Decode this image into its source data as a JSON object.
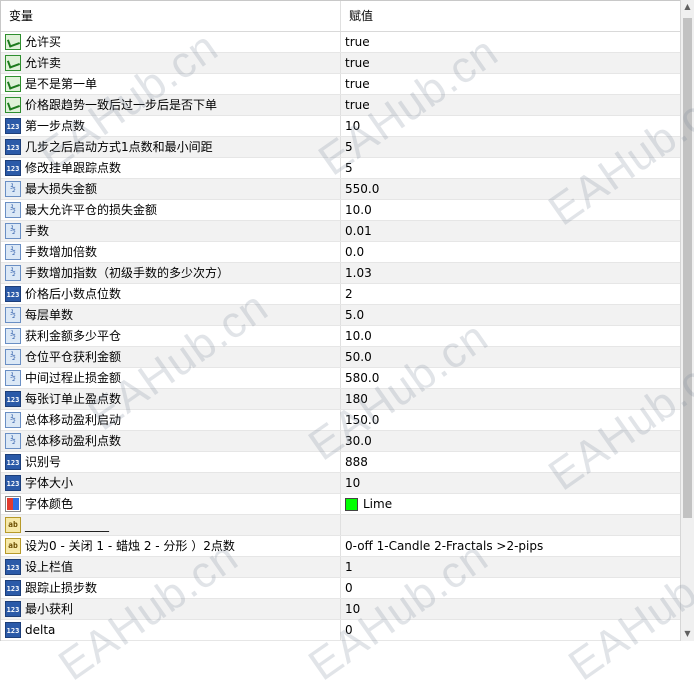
{
  "header": {
    "col_variable": "变量",
    "col_value": "赋值"
  },
  "rows": [
    {
      "icon": "bool-icon",
      "kind": "bool",
      "name": "允许买",
      "value": "true"
    },
    {
      "icon": "bool-icon",
      "kind": "bool",
      "name": "允许卖",
      "value": "true"
    },
    {
      "icon": "bool-icon",
      "kind": "bool",
      "name": "是不是第一单",
      "value": "true"
    },
    {
      "icon": "bool-icon",
      "kind": "bool",
      "name": "价格跟趋势一致后过一步后是否下单",
      "value": "true"
    },
    {
      "icon": "int-icon",
      "kind": "int",
      "name": "第一步点数",
      "value": "10"
    },
    {
      "icon": "int-icon",
      "kind": "int",
      "name": "几步之后启动方式1点数和最小间距",
      "value": "5"
    },
    {
      "icon": "int-icon",
      "kind": "int",
      "name": "修改挂单跟踪点数",
      "value": "5"
    },
    {
      "icon": "double-icon",
      "kind": "dbl",
      "name": "最大损失金额",
      "value": "550.0"
    },
    {
      "icon": "double-icon",
      "kind": "dbl",
      "name": "最大允许平仓的损失金额",
      "value": "10.0"
    },
    {
      "icon": "double-icon",
      "kind": "dbl",
      "name": "手数",
      "value": "0.01"
    },
    {
      "icon": "double-icon",
      "kind": "dbl",
      "name": "手数增加倍数",
      "value": "0.0"
    },
    {
      "icon": "double-icon",
      "kind": "dbl",
      "name": "手数增加指数（初级手数的多少次方）",
      "value": "1.03"
    },
    {
      "icon": "int-icon",
      "kind": "int",
      "name": "价格后小数点位数",
      "value": "2"
    },
    {
      "icon": "double-icon",
      "kind": "dbl",
      "name": "每层单数",
      "value": "5.0"
    },
    {
      "icon": "double-icon",
      "kind": "dbl",
      "name": "获利金额多少平仓",
      "value": "10.0"
    },
    {
      "icon": "double-icon",
      "kind": "dbl",
      "name": "仓位平仓获利金额",
      "value": "50.0"
    },
    {
      "icon": "double-icon",
      "kind": "dbl",
      "name": "中间过程止损金额",
      "value": "580.0"
    },
    {
      "icon": "int-icon",
      "kind": "int",
      "name": "每张订单止盈点数",
      "value": "180"
    },
    {
      "icon": "double-icon",
      "kind": "dbl",
      "name": "总体移动盈利启动",
      "value": "150.0"
    },
    {
      "icon": "double-icon",
      "kind": "dbl",
      "name": "总体移动盈利点数",
      "value": "30.0"
    },
    {
      "icon": "int-icon",
      "kind": "int",
      "name": "识别号",
      "value": "888"
    },
    {
      "icon": "int-icon",
      "kind": "int",
      "name": "字体大小",
      "value": "10"
    },
    {
      "icon": "color-icon",
      "kind": "clr",
      "name": "字体颜色",
      "value": "Lime",
      "swatch": "#00ff00"
    },
    {
      "icon": "string-icon",
      "kind": "str",
      "name": "______________",
      "value": ""
    },
    {
      "icon": "string-icon",
      "kind": "str",
      "name": "设为0 - 关闭 1 - 蜡烛 2 - 分形 ）2点数",
      "value": "0-off  1-Candle  2-Fractals  >2-pips"
    },
    {
      "icon": "int-icon",
      "kind": "int",
      "name": "设上栏值",
      "value": "1"
    },
    {
      "icon": "int-icon",
      "kind": "int",
      "name": "跟踪止损步数",
      "value": "0"
    },
    {
      "icon": "int-icon",
      "kind": "int",
      "name": "最小获利",
      "value": "10"
    },
    {
      "icon": "int-icon",
      "kind": "int",
      "name": "delta",
      "value": "0"
    }
  ],
  "icon_text": {
    "int": "123",
    "dbl": "½",
    "str": "ab"
  },
  "watermark": "EAHub.cn",
  "colors": {
    "alt_row": "#f2f2f2",
    "lime": "#00ff00"
  }
}
